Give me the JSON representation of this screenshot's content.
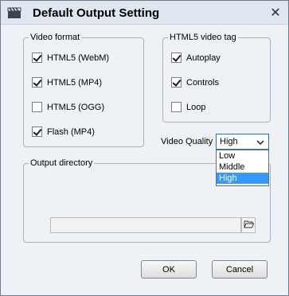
{
  "window": {
    "title": "Default Output Setting",
    "close_glyph": "✕"
  },
  "video_format": {
    "legend": "Video format",
    "items": [
      {
        "label": "HTML5 (WebM)",
        "checked": true
      },
      {
        "label": "HTML5 (MP4)",
        "checked": true
      },
      {
        "label": "HTML5 (OGG)",
        "checked": false
      },
      {
        "label": "Flash (MP4)",
        "checked": true
      }
    ]
  },
  "html5_tag": {
    "legend": "HTML5 video tag",
    "items": [
      {
        "label": "Autoplay",
        "checked": true
      },
      {
        "label": "Controls",
        "checked": true
      },
      {
        "label": "Loop",
        "checked": false
      }
    ]
  },
  "quality": {
    "label": "Video Quality",
    "selected": "High",
    "options": [
      "Low",
      "Middle",
      "High"
    ]
  },
  "output": {
    "legend": "Output directory",
    "path": ""
  },
  "buttons": {
    "ok": "OK",
    "cancel": "Cancel"
  },
  "icons": {
    "app": "video-clapper-icon",
    "folder": "folder-open-icon",
    "caret": "chevron-down-icon",
    "close": "close-icon"
  }
}
